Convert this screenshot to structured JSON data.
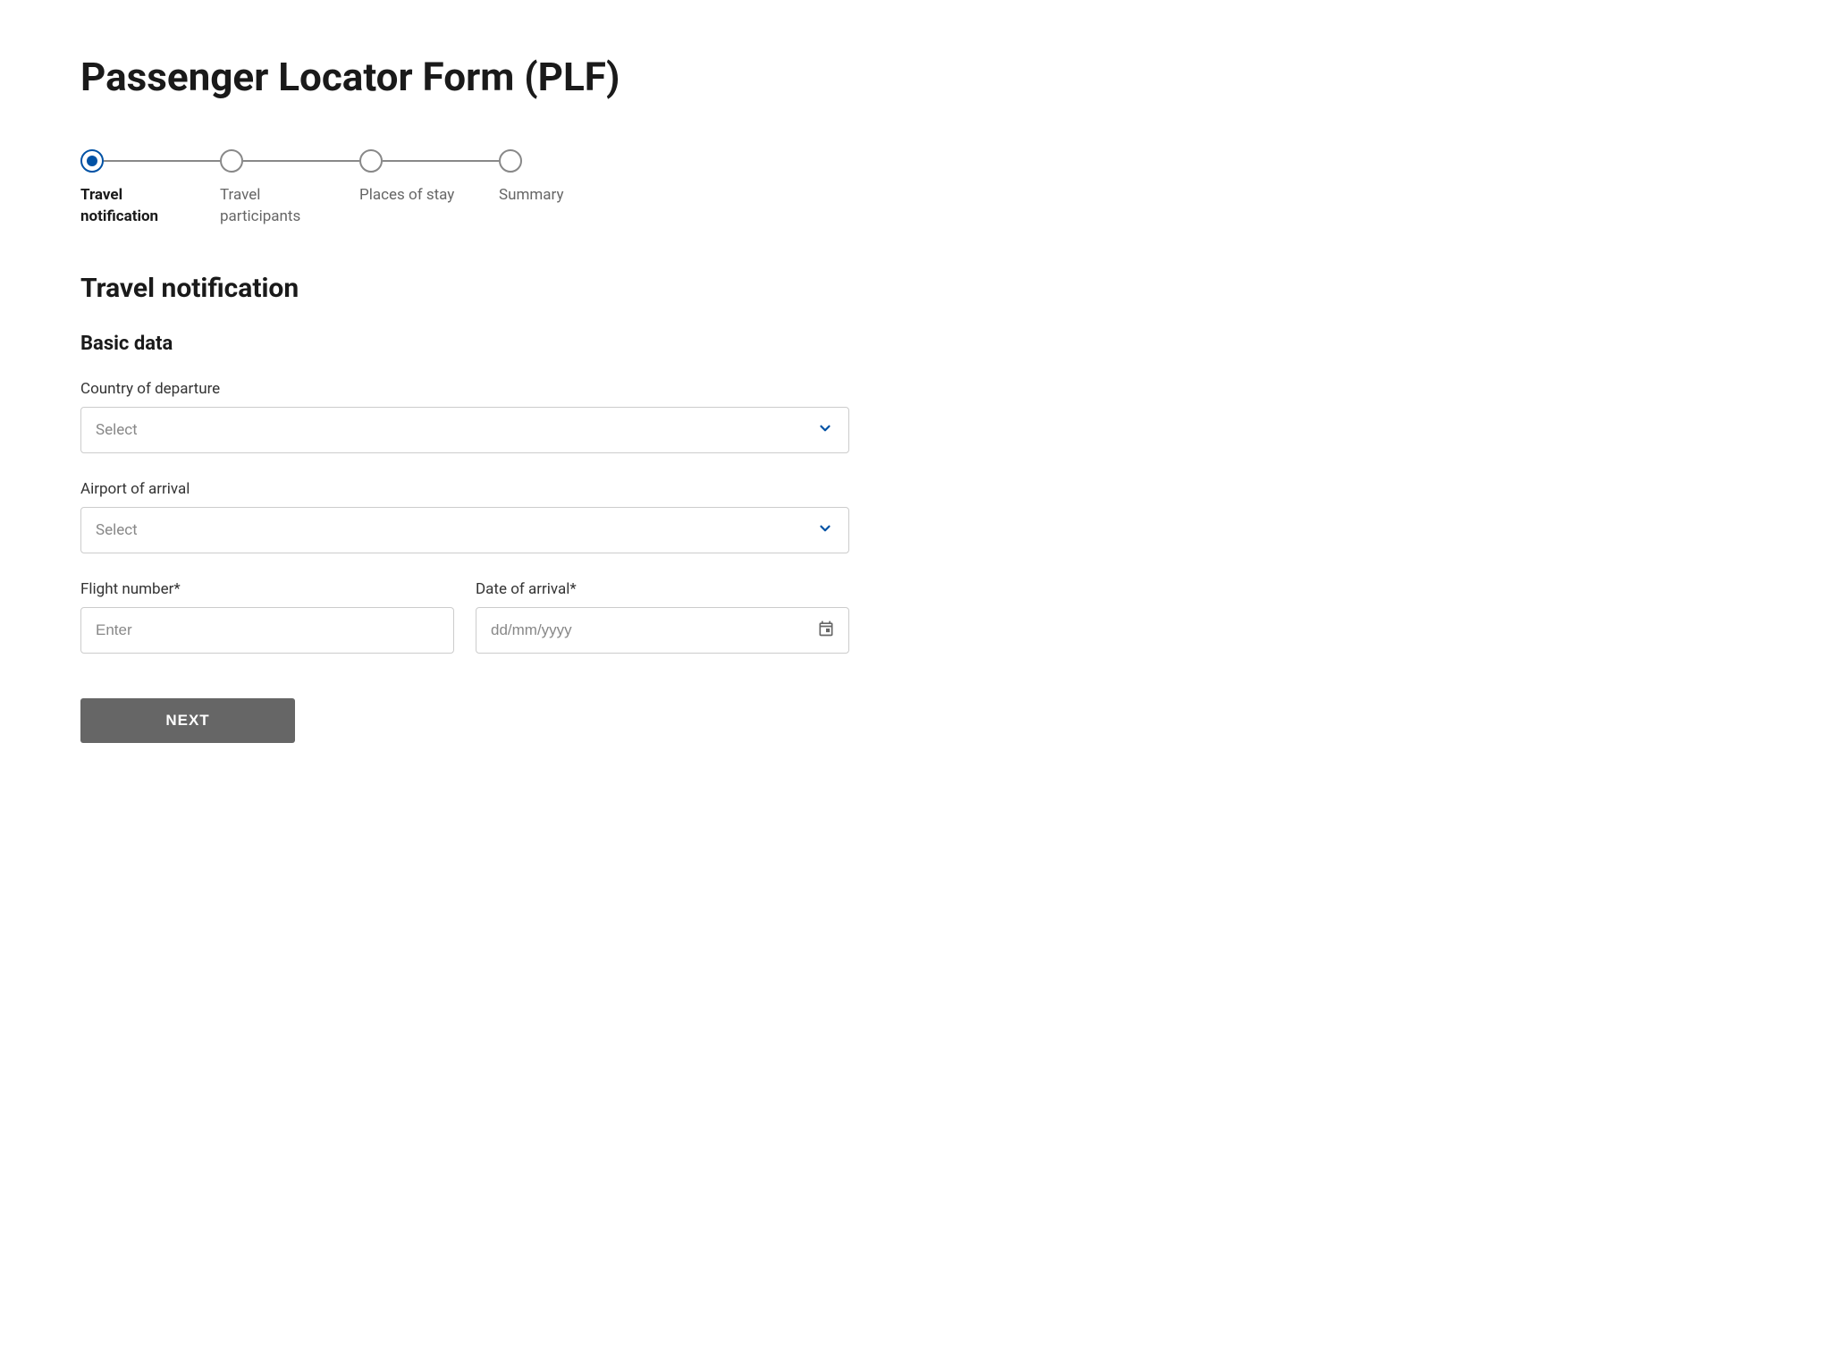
{
  "page_title": "Passenger Locator Form (PLF)",
  "stepper": {
    "steps": [
      {
        "label": "Travel notification",
        "active": true
      },
      {
        "label": "Travel participants",
        "active": false
      },
      {
        "label": "Places of stay",
        "active": false
      },
      {
        "label": "Summary",
        "active": false
      }
    ]
  },
  "section_title": "Travel notification",
  "subsection_title": "Basic data",
  "fields": {
    "country_of_departure": {
      "label": "Country of departure",
      "placeholder": "Select"
    },
    "airport_of_arrival": {
      "label": "Airport of arrival",
      "placeholder": "Select"
    },
    "flight_number": {
      "label": "Flight number*",
      "placeholder": "Enter"
    },
    "date_of_arrival": {
      "label": "Date of arrival*",
      "placeholder": "dd/mm/yyyy"
    }
  },
  "next_button": "NEXT",
  "colors": {
    "accent": "#0052a5",
    "button_bg": "#666666"
  }
}
